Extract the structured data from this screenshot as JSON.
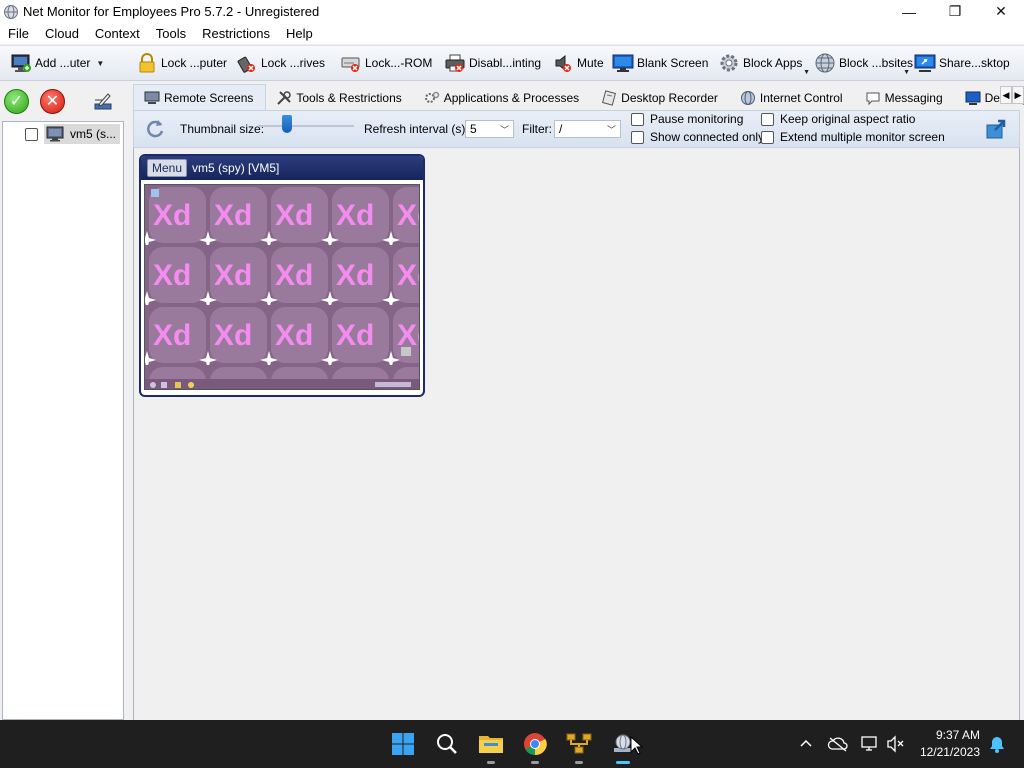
{
  "window": {
    "title": "Net Monitor for Employees Pro 5.7.2 - Unregistered",
    "minimize": "—",
    "restore": "❐",
    "close": "✕"
  },
  "menu": [
    "File",
    "Cloud",
    "Context",
    "Tools",
    "Restrictions",
    "Help"
  ],
  "toolbar": {
    "add_computer": "Add ...uter",
    "lock_computer": "Lock ...puter",
    "lock_drives": "Lock ...rives",
    "lock_cdrom": "Lock...-ROM",
    "disable_printing": "Disabl...inting",
    "mute": "Mute",
    "blank_screen": "Blank Screen",
    "block_apps": "Block Apps",
    "block_websites": "Block ...bsites",
    "share_desktop": "Share...sktop"
  },
  "tree": {
    "computer": "vm5 (s..."
  },
  "tabs": [
    "Remote Screens",
    "Tools & Restrictions",
    "Applications & Processes",
    "Desktop Recorder",
    "Internet Control",
    "Messaging",
    "Desktop Shar"
  ],
  "options": {
    "thumbnail_size_label": "Thumbnail size:",
    "thumbnail_size_level": 0.3,
    "refresh_label": "Refresh interval (s):",
    "refresh_value": "5",
    "filter_label": "Filter:",
    "filter_value": "/",
    "pause_monitoring": "Pause monitoring",
    "show_connected_only": "Show connected only",
    "keep_aspect": "Keep original aspect ratio",
    "extend_monitor": "Extend multiple monitor screen"
  },
  "screen_card": {
    "menu_button": "Menu",
    "title": "vm5 (spy) [VM5]",
    "wallpaper_text": "Xd"
  },
  "taskbar": {
    "time": "9:37 AM",
    "date": "12/21/2023"
  },
  "colors": {
    "title_bar": "#ffffff",
    "card_header": "#1c2b66",
    "taskbar": "#1f1f1f",
    "active_indicator": "#4cc2ff",
    "wallpaper": "#8a6a8c",
    "wallpaper_text": "#f48cf0"
  }
}
